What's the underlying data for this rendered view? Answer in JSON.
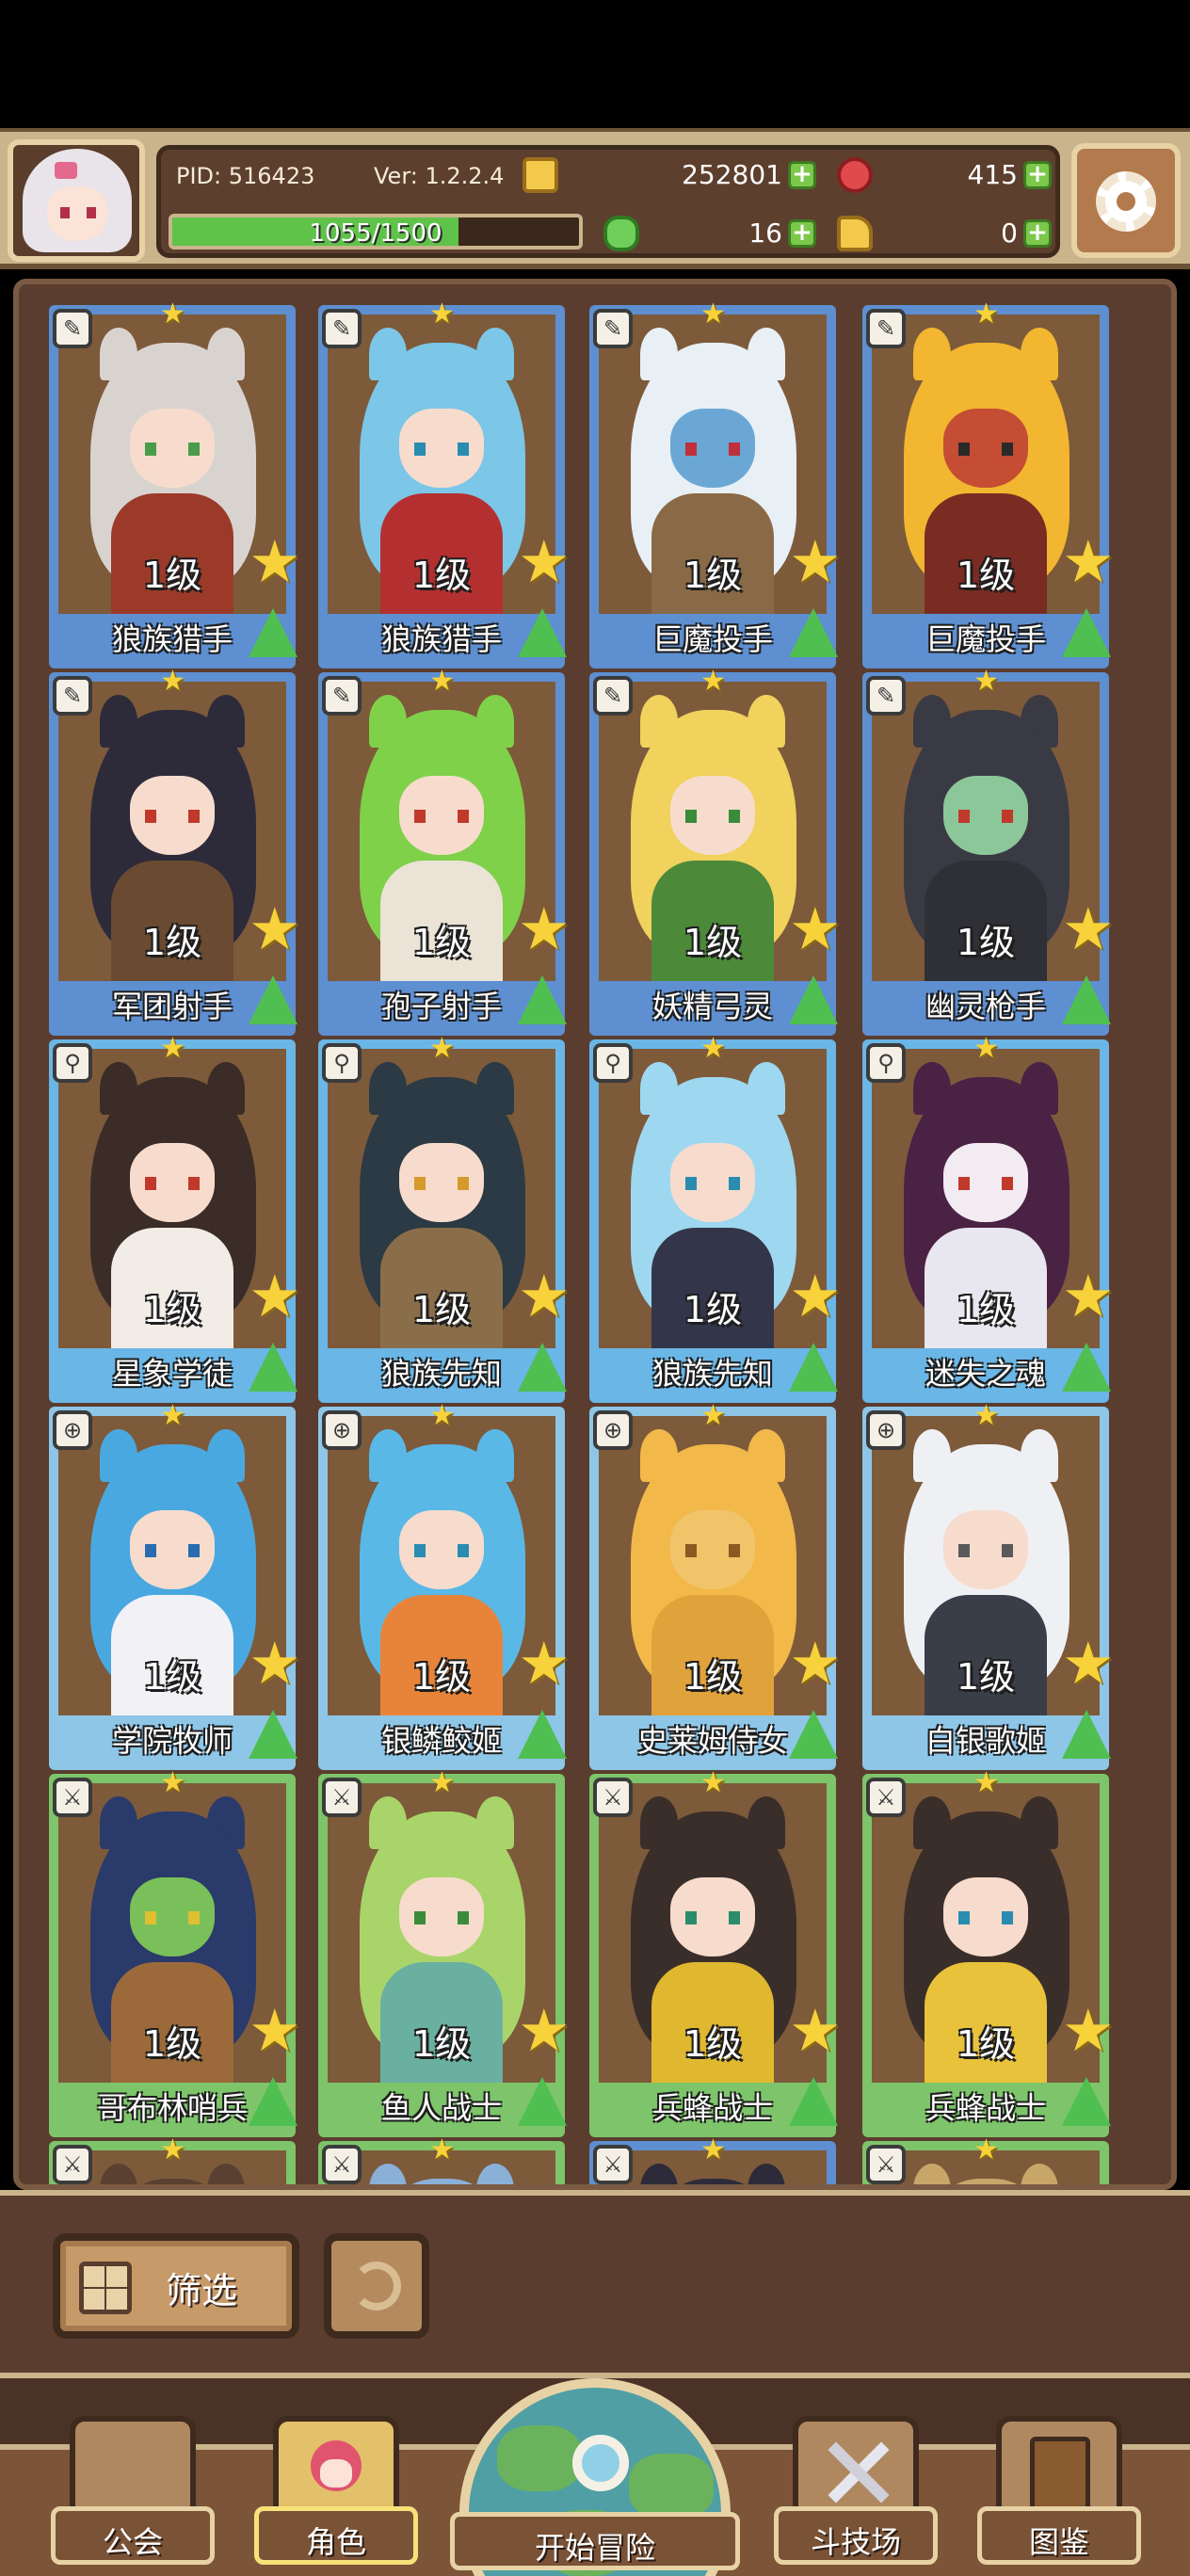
{
  "header": {
    "pid": "PID: 516423",
    "version": "Ver: 1.2.2.4",
    "gold": "252801",
    "gems": "415",
    "clover": "16",
    "keys": "0",
    "xp_text": "1055/1500",
    "xp_current": 1055,
    "xp_max": 1500
  },
  "roster": {
    "cards": [
      {
        "name": "狼族猎手",
        "level": "1级",
        "class_icon": "leaf-icon",
        "class_glyph": "✎",
        "frame": "#5d8fd1",
        "hair": "#d9d3d0",
        "skin": "#f7dccd",
        "outfit": "#9c3a2a",
        "eye": "#4a9c4a"
      },
      {
        "name": "狼族猎手",
        "level": "1级",
        "class_icon": "leaf-icon",
        "class_glyph": "✎",
        "frame": "#5d8fd1",
        "hair": "#7cc6e8",
        "skin": "#f7dccd",
        "outfit": "#b43030",
        "eye": "#2a8cb0"
      },
      {
        "name": "巨魔投手",
        "level": "1级",
        "class_icon": "leaf-icon",
        "class_glyph": "✎",
        "frame": "#5d8fd1",
        "hair": "#e8f0f6",
        "skin": "#6aa7d4",
        "outfit": "#8a6a46",
        "eye": "#c02f3c"
      },
      {
        "name": "巨魔投手",
        "level": "1级",
        "class_icon": "leaf-icon",
        "class_glyph": "✎",
        "frame": "#5d8fd1",
        "hair": "#f2b630",
        "skin": "#c44d34",
        "outfit": "#7a2b22",
        "eye": "#2a2a2a"
      },
      {
        "name": "军团射手",
        "level": "1级",
        "class_icon": "leaf-icon",
        "class_glyph": "✎",
        "frame": "#5d8fd1",
        "hair": "#2d2b3a",
        "skin": "#f7dccd",
        "outfit": "#6a4a30",
        "eye": "#c0392b"
      },
      {
        "name": "孢子射手",
        "level": "1级",
        "class_icon": "leaf-icon",
        "class_glyph": "✎",
        "frame": "#5d8fd1",
        "hair": "#7fd14a",
        "skin": "#f7dccd",
        "outfit": "#eae3d6",
        "eye": "#c0392b"
      },
      {
        "name": "妖精弓灵",
        "level": "1级",
        "class_icon": "leaf-icon",
        "class_glyph": "✎",
        "frame": "#5d8fd1",
        "hair": "#f0d25c",
        "skin": "#f7dccd",
        "outfit": "#4c8a3a",
        "eye": "#3a8c3a"
      },
      {
        "name": "幽灵枪手",
        "level": "1级",
        "class_icon": "leaf-icon",
        "class_glyph": "✎",
        "frame": "#5d8fd1",
        "hair": "#3a3a44",
        "skin": "#8cc79a",
        "outfit": "#2f2f36",
        "eye": "#c0392b"
      },
      {
        "name": "星象学徒",
        "level": "1级",
        "class_icon": "staff-icon",
        "class_glyph": "⚲",
        "frame": "#6ab6e6",
        "hair": "#3b2c28",
        "skin": "#f7dccd",
        "outfit": "#f2ece6",
        "eye": "#c0392b"
      },
      {
        "name": "狼族先知",
        "level": "1级",
        "class_icon": "staff-icon",
        "class_glyph": "⚲",
        "frame": "#6ab6e6",
        "hair": "#2b3a44",
        "skin": "#f7dccd",
        "outfit": "#8a6e4a",
        "eye": "#d49a2a"
      },
      {
        "name": "狼族先知",
        "level": "1级",
        "class_icon": "staff-icon",
        "class_glyph": "⚲",
        "frame": "#6ab6e6",
        "hair": "#9ed8f0",
        "skin": "#f7dccd",
        "outfit": "#33364a",
        "eye": "#2a8cb0"
      },
      {
        "name": "迷失之魂",
        "level": "1级",
        "class_icon": "staff-icon",
        "class_glyph": "⚲",
        "frame": "#6ab6e6",
        "hair": "#4a2244",
        "skin": "#f2ecf2",
        "outfit": "#e8e6ee",
        "eye": "#c0392b"
      },
      {
        "name": "学院牧师",
        "level": "1级",
        "class_icon": "cross-icon",
        "class_glyph": "⊕",
        "frame": "#8ec6e8",
        "hair": "#4aa8e0",
        "skin": "#f7dccd",
        "outfit": "#f2f2f6",
        "eye": "#2a6cb0"
      },
      {
        "name": "银鳞鲛姬",
        "level": "1级",
        "class_icon": "cross-icon",
        "class_glyph": "⊕",
        "frame": "#8ec6e8",
        "hair": "#5ab8e6",
        "skin": "#f7dccd",
        "outfit": "#e8843a",
        "eye": "#2a8cb0"
      },
      {
        "name": "史莱姆侍女",
        "level": "1级",
        "class_icon": "cross-icon",
        "class_glyph": "⊕",
        "frame": "#8ec6e8",
        "hair": "#f2b84a",
        "skin": "#f2c46a",
        "outfit": "#e0a23a",
        "eye": "#8a5a20"
      },
      {
        "name": "白银歌姬",
        "level": "1级",
        "class_icon": "cross-icon",
        "class_glyph": "⊕",
        "frame": "#8ec6e8",
        "hair": "#eef0f4",
        "skin": "#f7dccd",
        "outfit": "#3a3e48",
        "eye": "#5a5a5a"
      },
      {
        "name": "哥布林哨兵",
        "level": "1级",
        "class_icon": "sword-icon",
        "class_glyph": "⚔",
        "frame": "#7dc46a",
        "hair": "#2a3a6a",
        "skin": "#7ac05a",
        "outfit": "#9c6a3a",
        "eye": "#e0c030"
      },
      {
        "name": "鱼人战士",
        "level": "1级",
        "class_icon": "sword-icon",
        "class_glyph": "⚔",
        "frame": "#7dc46a",
        "hair": "#a8d46a",
        "skin": "#f7dccd",
        "outfit": "#6ab0a0",
        "eye": "#3a8c3a"
      },
      {
        "name": "兵蜂战士",
        "level": "1级",
        "class_icon": "sword-icon",
        "class_glyph": "⚔",
        "frame": "#7dc46a",
        "hair": "#3a2e2a",
        "skin": "#f7dccd",
        "outfit": "#e0b830",
        "eye": "#2a8c6a"
      },
      {
        "name": "兵蜂战士",
        "level": "1级",
        "class_icon": "sword-icon",
        "class_glyph": "⚔",
        "frame": "#7dc46a",
        "hair": "#3a2e2a",
        "skin": "#f7dccd",
        "outfit": "#e8c23a",
        "eye": "#2a8cb0"
      },
      {
        "name": "",
        "level": "",
        "class_icon": "sword-icon",
        "class_glyph": "⚔",
        "frame": "#7dc46a",
        "hair": "#5a4030",
        "skin": "#f7dccd",
        "outfit": "#6a4a30",
        "eye": "#333333"
      },
      {
        "name": "",
        "level": "",
        "class_icon": "sword-icon",
        "class_glyph": "⚔",
        "frame": "#7dc46a",
        "hair": "#8ab0d8",
        "skin": "#f7dccd",
        "outfit": "#6a4a30",
        "eye": "#333333"
      },
      {
        "name": "",
        "level": "",
        "class_icon": "sword-icon",
        "class_glyph": "⚔",
        "frame": "#5d8fd1",
        "hair": "#2d2b3a",
        "skin": "#f7dccd",
        "outfit": "#6a4a30",
        "eye": "#333333"
      },
      {
        "name": "",
        "level": "",
        "class_icon": "sword-icon",
        "class_glyph": "⚔",
        "frame": "#7dc46a",
        "hair": "#c8a66a",
        "skin": "#f7dccd",
        "outfit": "#6a4a30",
        "eye": "#333333"
      }
    ]
  },
  "filter": {
    "filter_label": "筛选"
  },
  "nav": {
    "guild": "公会",
    "characters": "角色",
    "adventure": "开始冒险",
    "arena": "斗技场",
    "codex": "图鉴"
  }
}
